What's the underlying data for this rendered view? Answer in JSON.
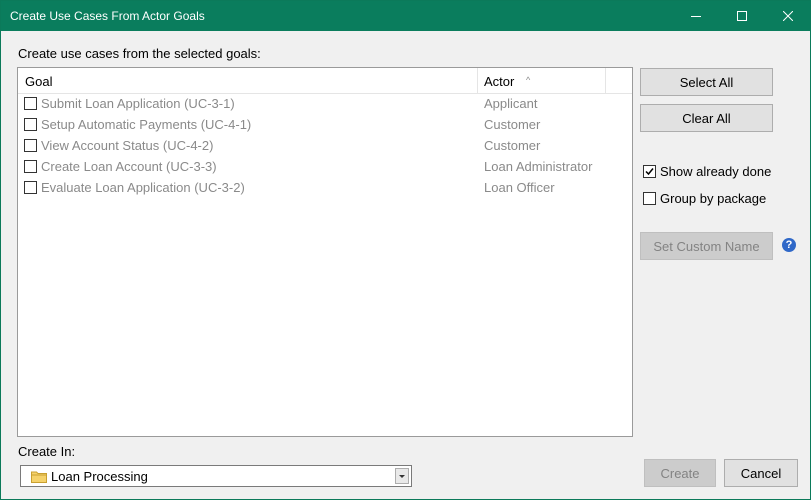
{
  "window": {
    "title": "Create Use Cases From Actor Goals"
  },
  "heading": "Create use cases from the selected goals:",
  "table": {
    "columns": {
      "goal": "Goal",
      "actor": "Actor"
    },
    "rows": [
      {
        "goal": "Submit Loan Application (UC-3-1)",
        "actor": "Applicant",
        "checked": false
      },
      {
        "goal": "Setup Automatic Payments (UC-4-1)",
        "actor": "Customer",
        "checked": false
      },
      {
        "goal": "View Account Status (UC-4-2)",
        "actor": "Customer",
        "checked": false
      },
      {
        "goal": "Create Loan Account (UC-3-3)",
        "actor": "Loan Administrator",
        "checked": false
      },
      {
        "goal": "Evaluate Loan Application (UC-3-2)",
        "actor": "Loan Officer",
        "checked": false
      }
    ]
  },
  "buttons": {
    "select_all": "Select All",
    "clear_all": "Clear All",
    "set_custom_name": "Set Custom Name",
    "create": "Create",
    "cancel": "Cancel"
  },
  "options": {
    "show_already_done": {
      "label": "Show already done",
      "checked": true
    },
    "group_by_package": {
      "label": "Group by package",
      "checked": false
    }
  },
  "create_in": {
    "label": "Create In:",
    "value": "Loan Processing"
  },
  "icons": {
    "help": "help-icon",
    "folder": "folder-icon",
    "sort": "sort-arrow-icon"
  },
  "colors": {
    "titlebar": "#0a7d5d",
    "help": "#2f68c8"
  }
}
